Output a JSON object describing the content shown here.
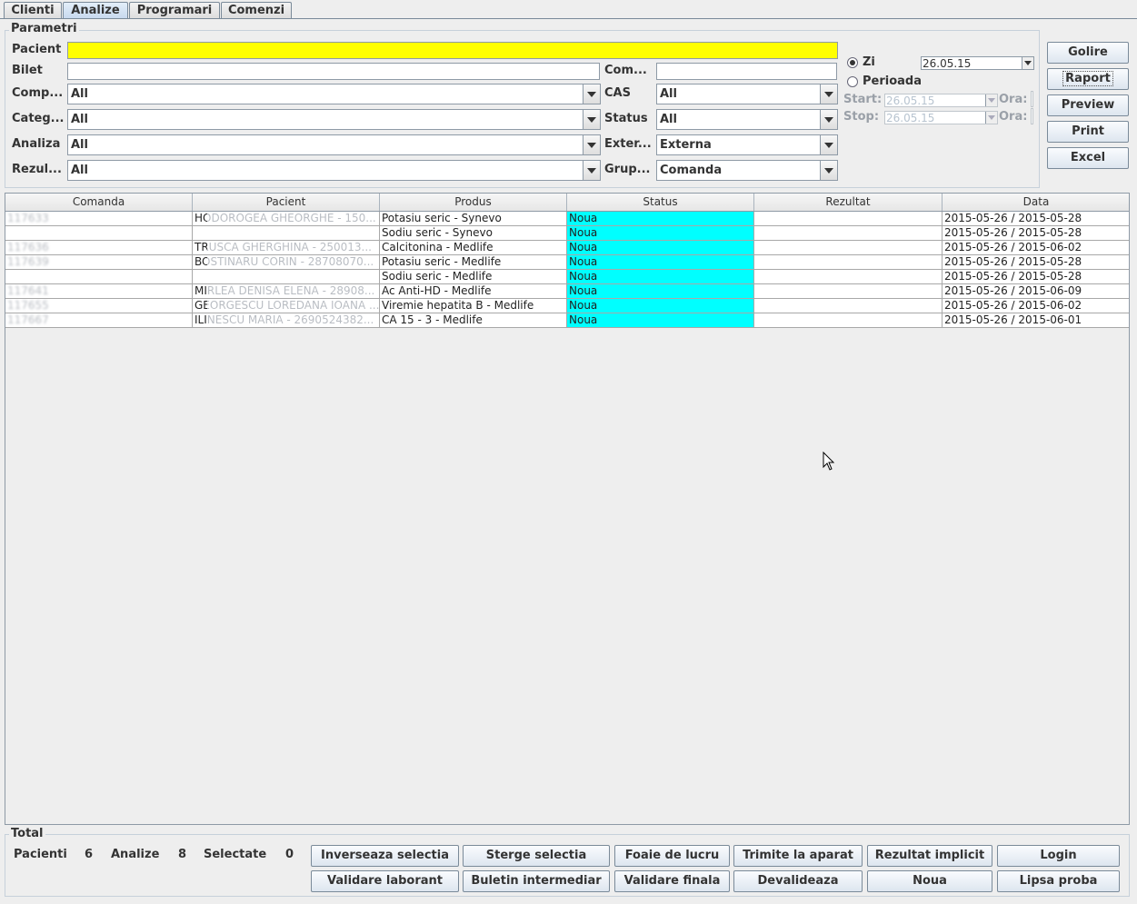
{
  "tabs": [
    "Clienti",
    "Analize",
    "Programari",
    "Comenzi"
  ],
  "parametri": {
    "title": "Parametri",
    "pacient_label": "Pacient",
    "pacient_value": "",
    "bilet_label": "Bilet",
    "bilet_value": "",
    "com_label": "Com...",
    "com_value": "",
    "comp_label": "Comp...",
    "comp_value": "All",
    "cas_label": "CAS",
    "cas_value": "All",
    "categ_label": "Categ...",
    "categ_value": "All",
    "status_label": "Status",
    "status_value": "All",
    "analiza_label": "Analiza",
    "analiza_value": "All",
    "exter_label": "Exter...",
    "exter_value": "Externa",
    "rezul_label": "Rezul...",
    "rezul_value": "All",
    "grup_label": "Grup...",
    "grup_value": "Comanda"
  },
  "period": {
    "zi_label": "Zi",
    "zi_date": "26.05.15",
    "perioada_label": "Perioada",
    "start_label": "Start:",
    "start_date": "26.05.15",
    "stop_label": "Stop:",
    "stop_date": "26.05.15",
    "ora_label": "Ora:"
  },
  "side_buttons": [
    "Golire",
    "Raport",
    "Preview",
    "Print",
    "Excel"
  ],
  "table": {
    "columns": [
      "Comanda",
      "Pacient",
      "Produs",
      "Status",
      "Rezultat",
      "Data"
    ],
    "rows": [
      [
        "117633",
        "HODOROGEA GHEORGHE - 150...",
        "Potasiu seric - Synevo",
        "Noua",
        "",
        "2015-05-26 / 2015-05-28"
      ],
      [
        "",
        "",
        "Sodiu seric - Synevo",
        "Noua",
        "",
        "2015-05-26 / 2015-05-28"
      ],
      [
        "117636",
        "TRUSCA GHERGHINA - 250013...",
        "Calcitonina - Medlife",
        "Noua",
        "",
        "2015-05-26 / 2015-06-02"
      ],
      [
        "117639",
        "BOSTINARU CORIN - 28708070...",
        "Potasiu seric - Medlife",
        "Noua",
        "",
        "2015-05-26 / 2015-05-28"
      ],
      [
        "",
        "",
        "Sodiu seric - Medlife",
        "Noua",
        "",
        "2015-05-26 / 2015-05-28"
      ],
      [
        "117641",
        "MIRLEA DENISA ELENA - 28908...",
        "Ac Anti-HD - Medlife",
        "Noua",
        "",
        "2015-05-26 / 2015-06-09"
      ],
      [
        "117655",
        "GEORGESCU LOREDANA IOANA ...",
        "Viremie hepatita B - Medlife",
        "Noua",
        "",
        "2015-05-26 / 2015-06-02"
      ],
      [
        "117667",
        "ILINESCU MARIA - 2690524382...",
        "CA 15 - 3 - Medlife",
        "Noua",
        "",
        "2015-05-26 / 2015-06-01"
      ]
    ]
  },
  "total": {
    "title": "Total",
    "pacienti_label": "Pacienti",
    "pacienti_value": "6",
    "analize_label": "Analize",
    "analize_value": "8",
    "selectate_label": "Selectate",
    "selectate_value": "0"
  },
  "bottom_buttons_row1": [
    "Inverseaza selectia",
    "Sterge selectia",
    "Foaie de lucru",
    "Trimite la aparat",
    "Rezultat implicit",
    "Login"
  ],
  "bottom_buttons_row2": [
    "Validare laborant",
    "Buletin intermediar",
    "Validare finala",
    "Devalideaza",
    "Noua",
    "Lipsa proba"
  ],
  "colors": {
    "pacient_field": "#ffff00",
    "status_cell": "#00ffff"
  }
}
